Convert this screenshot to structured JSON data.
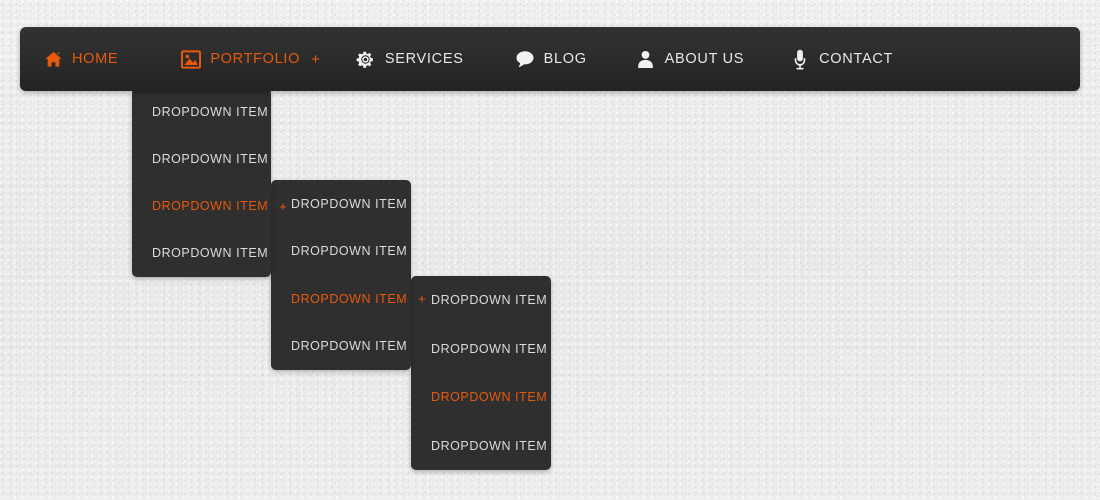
{
  "navbar": {
    "items": [
      {
        "label": "HOME",
        "icon": "home-icon",
        "state": "active",
        "has_submenu": false,
        "submenu_indicator": ""
      },
      {
        "label": "PORTFOLIO",
        "icon": "image-icon",
        "state": "active",
        "has_submenu": true,
        "submenu_indicator": "+"
      },
      {
        "label": "SERVICES",
        "icon": "gear-icon",
        "state": "inactive",
        "has_submenu": false,
        "submenu_indicator": ""
      },
      {
        "label": "BLOG",
        "icon": "comment-icon",
        "state": "inactive",
        "has_submenu": false,
        "submenu_indicator": ""
      },
      {
        "label": "ABOUT US",
        "icon": "user-icon",
        "state": "inactive",
        "has_submenu": false,
        "submenu_indicator": ""
      },
      {
        "label": "CONTACT",
        "icon": "microphone-icon",
        "state": "inactive",
        "has_submenu": false,
        "submenu_indicator": ""
      }
    ]
  },
  "dropdown_level_1": {
    "items": [
      {
        "label": "DROPDOWN ITEM",
        "state": "inactive",
        "submenu_indicator": ""
      },
      {
        "label": "DROPDOWN ITEM",
        "state": "inactive",
        "submenu_indicator": ""
      },
      {
        "label": "DROPDOWN ITEM",
        "state": "active",
        "submenu_indicator": "+"
      },
      {
        "label": "DROPDOWN ITEM",
        "state": "inactive",
        "submenu_indicator": ""
      }
    ]
  },
  "dropdown_level_2": {
    "items": [
      {
        "label": "DROPDOWN ITEM",
        "state": "inactive",
        "submenu_indicator": ""
      },
      {
        "label": "DROPDOWN ITEM",
        "state": "inactive",
        "submenu_indicator": ""
      },
      {
        "label": "DROPDOWN ITEM",
        "state": "active",
        "submenu_indicator": "+"
      },
      {
        "label": "DROPDOWN ITEM",
        "state": "inactive",
        "submenu_indicator": ""
      }
    ]
  },
  "dropdown_level_3": {
    "items": [
      {
        "label": "DROPDOWN ITEM",
        "state": "inactive",
        "submenu_indicator": ""
      },
      {
        "label": "DROPDOWN ITEM",
        "state": "inactive",
        "submenu_indicator": ""
      },
      {
        "label": "DROPDOWN ITEM",
        "state": "active",
        "submenu_indicator": ""
      },
      {
        "label": "DROPDOWN ITEM",
        "state": "inactive",
        "submenu_indicator": ""
      }
    ]
  },
  "colors": {
    "accent_orange": "#e8590c",
    "navbar_dark": "#2d2d2d",
    "dropdown_dark": "#2f2f2f",
    "text_light": "#e8e8e8",
    "page_background": "#ebebeb"
  }
}
